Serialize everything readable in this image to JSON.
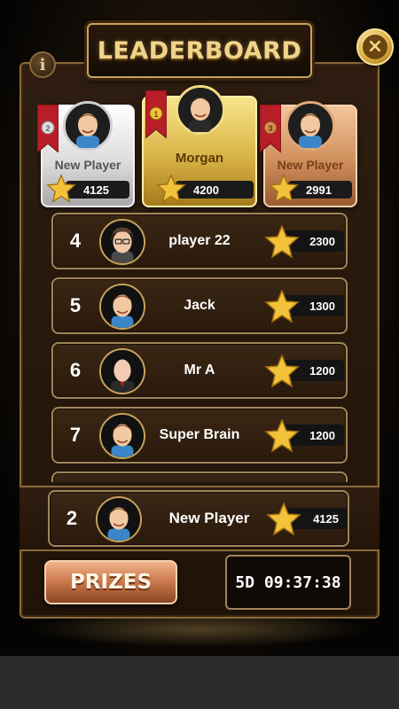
{
  "header": {
    "title": "LEADERBOARD"
  },
  "buttons": {
    "info_glyph": "i",
    "close_glyph": "×",
    "prizes_label": "PRIZES"
  },
  "timer": {
    "value": "5D 09:37:38"
  },
  "podium": [
    {
      "place": 2,
      "place_label": "2",
      "medal": "silver",
      "name": "New Player",
      "score": "4125"
    },
    {
      "place": 1,
      "place_label": "1",
      "medal": "gold",
      "name": "Morgan",
      "score": "4200"
    },
    {
      "place": 3,
      "place_label": "3",
      "medal": "bronze",
      "name": "New Player",
      "score": "2991"
    }
  ],
  "list": [
    {
      "rank": "4",
      "name": "player 22",
      "score": "2300"
    },
    {
      "rank": "5",
      "name": "Jack",
      "score": "1300"
    },
    {
      "rank": "6",
      "name": "Mr A",
      "score": "1200"
    },
    {
      "rank": "7",
      "name": "Super Brain",
      "score": "1200"
    }
  ],
  "current_player": {
    "rank": "2",
    "name": "New Player",
    "score": "4125"
  },
  "colors": {
    "gold": "#d9b446",
    "silver": "#d9d9d9",
    "bronze": "#cf8f5c",
    "panel": "#2e1d10",
    "frame": "#a0855a"
  },
  "icons": [
    "info-icon",
    "close-icon",
    "star-icon",
    "ribbon-icon",
    "avatar-icon"
  ]
}
